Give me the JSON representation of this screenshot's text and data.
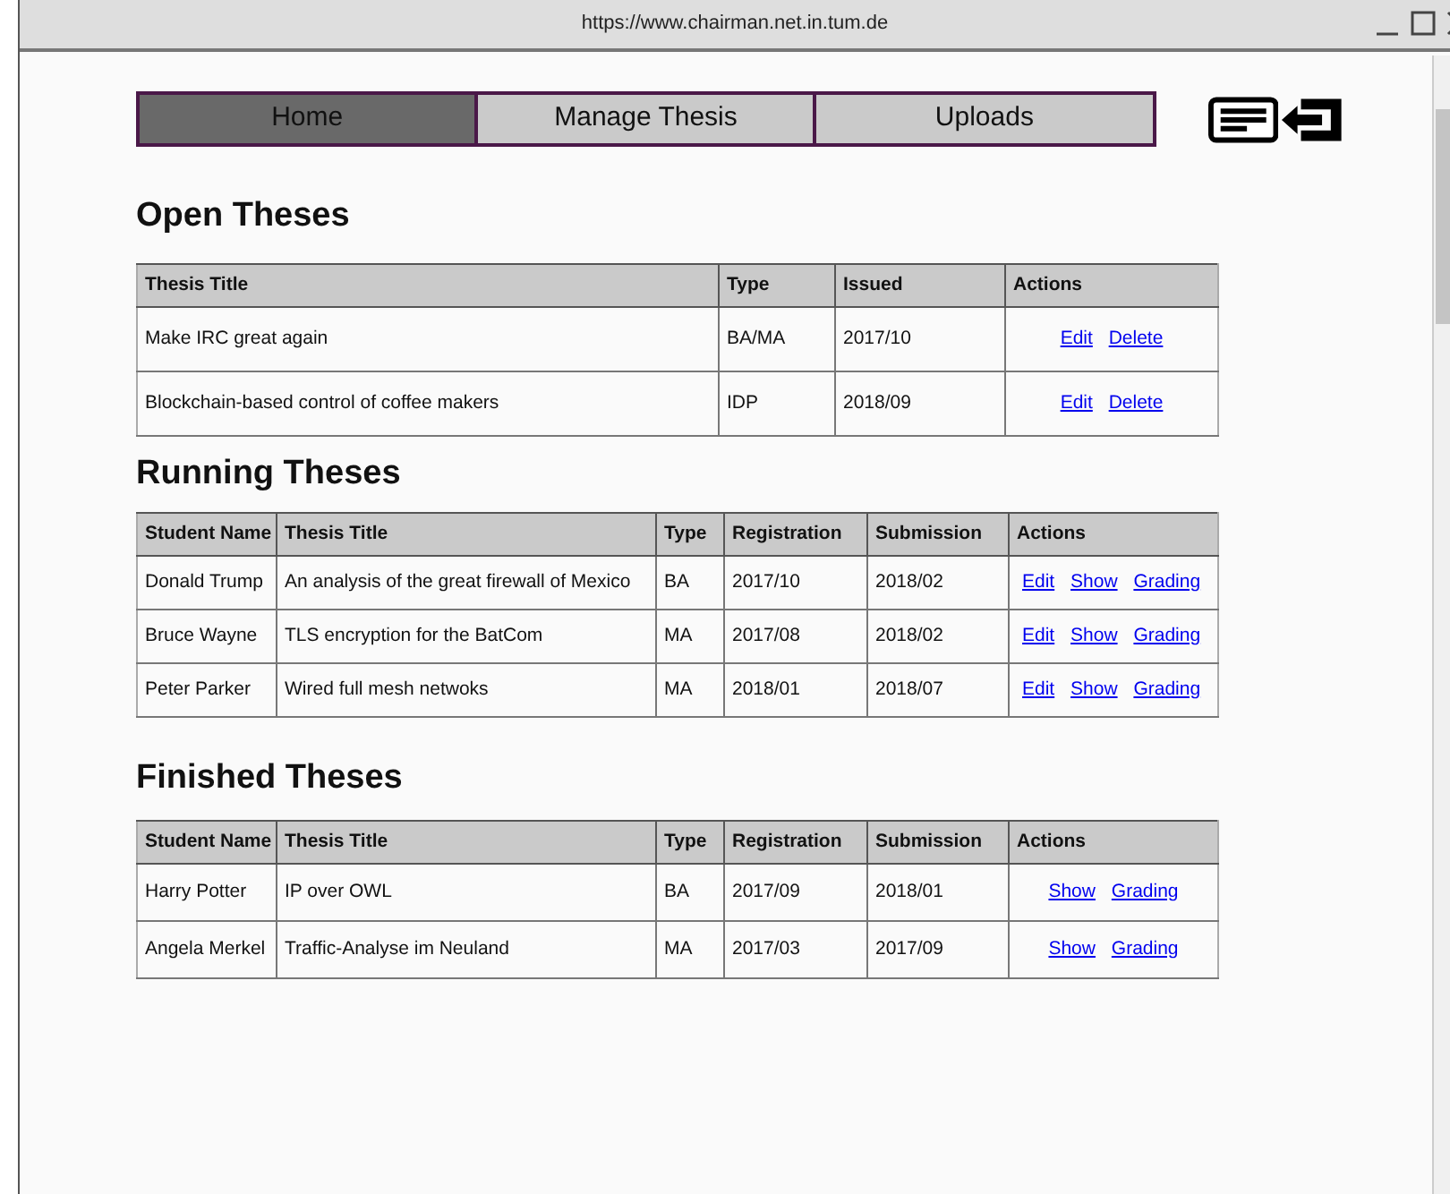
{
  "window": {
    "title": "https://www.chairman.net.in.tum.de"
  },
  "nav": [
    {
      "label": "Home",
      "selected": true
    },
    {
      "label": "Manage Thesis",
      "selected": false
    },
    {
      "label": "Uploads",
      "selected": false
    }
  ],
  "sections": [
    {
      "title": "Open Theses",
      "columns": [
        "Thesis Title",
        "Type",
        "Issued",
        "Actions"
      ],
      "rows": [
        {
          "cells": [
            "Make IRC great again",
            "BA/MA",
            "2017/10"
          ],
          "actions": [
            "Edit",
            "Delete"
          ]
        },
        {
          "cells": [
            "Blockchain-based control of coffee makers",
            "IDP",
            "2018/09"
          ],
          "actions": [
            "Edit",
            "Delete"
          ]
        }
      ]
    },
    {
      "title": "Running Theses",
      "columns": [
        "Student Name",
        "Thesis Title",
        "Type",
        "Registration",
        "Submission",
        "Actions"
      ],
      "rows": [
        {
          "cells": [
            "Donald Trump",
            "An analysis of the great firewall of Mexico",
            "BA",
            "2017/10",
            "2018/02"
          ],
          "actions": [
            "Edit",
            "Show",
            "Grading"
          ]
        },
        {
          "cells": [
            "Bruce Wayne",
            "TLS encryption for the BatCom",
            "MA",
            "2017/08",
            "2018/02"
          ],
          "actions": [
            "Edit",
            "Show",
            "Grading"
          ]
        },
        {
          "cells": [
            "Peter Parker",
            "Wired full mesh netwoks",
            "MA",
            "2018/01",
            "2018/07"
          ],
          "actions": [
            "Edit",
            "Show",
            "Grading"
          ]
        }
      ]
    },
    {
      "title": "Finished Theses",
      "columns": [
        "Student Name",
        "Thesis Title",
        "Type",
        "Registration",
        "Submission",
        "Actions"
      ],
      "rows": [
        {
          "cells": [
            "Harry Potter",
            "IP over OWL",
            "BA",
            "2017/09",
            "2018/01"
          ],
          "actions": [
            "Show",
            "Grading"
          ]
        },
        {
          "cells": [
            "Angela Merkel",
            "Traffic-Analyse im Neuland",
            "MA",
            "2017/03",
            "2017/09"
          ],
          "actions": [
            "Show",
            "Grading"
          ]
        }
      ]
    }
  ]
}
